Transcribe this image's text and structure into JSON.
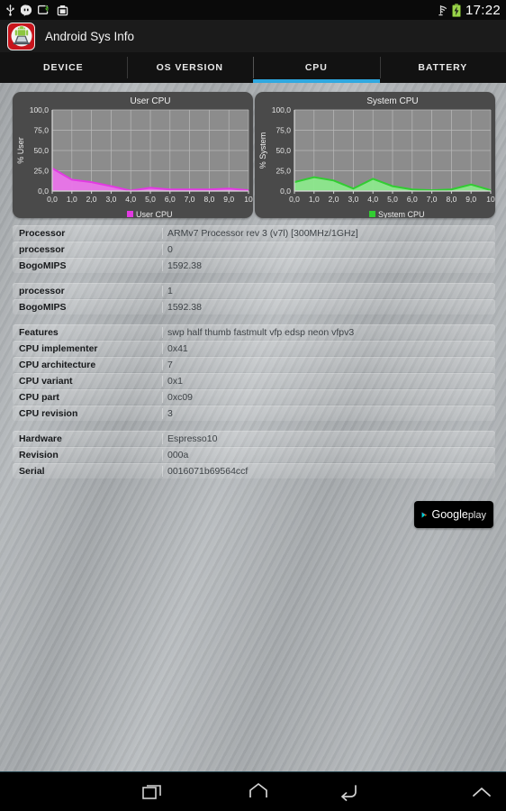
{
  "statusbar": {
    "time": "17:22",
    "icons": [
      "usb-icon",
      "hangouts-icon",
      "usb-transfer-icon",
      "screenshot-icon"
    ],
    "right_icons": [
      "wifi-icon",
      "battery-charging-icon"
    ]
  },
  "actionbar": {
    "app_title": "Android Sys Info",
    "logo": "android-sys-info-logo"
  },
  "tabs": [
    {
      "label": "DEVICE",
      "active": false
    },
    {
      "label": "OS VERSION",
      "active": false
    },
    {
      "label": "CPU",
      "active": true
    },
    {
      "label": "BATTERY",
      "active": false
    }
  ],
  "colors": {
    "accent": "#2fa8e0",
    "user_cpu": "#e23ae2",
    "user_cpu_fill": "#ea74ea",
    "system_cpu": "#32cc32",
    "system_cpu_fill": "#8ce88c",
    "chart_bg": "#8c8c8c",
    "chart_frame": "#4a4a4a"
  },
  "chart_data": [
    {
      "type": "area",
      "title": "User CPU",
      "ylabel": "% User",
      "xlabel": "",
      "legend": "User CPU",
      "legend_position": "bottom",
      "grid": true,
      "xlim": [
        0,
        10
      ],
      "ylim": [
        0,
        100
      ],
      "xticks": [
        "0,0",
        "1,0",
        "2,0",
        "3,0",
        "4,0",
        "5,0",
        "6,0",
        "7,0",
        "8,0",
        "9,0",
        "10,0"
      ],
      "yticks": [
        "0,0",
        "25,0",
        "50,0",
        "75,0",
        "100,0"
      ],
      "x": [
        0,
        1,
        2,
        3,
        4,
        5,
        6,
        7,
        8,
        9,
        10
      ],
      "values": [
        28,
        14,
        11,
        6,
        0.5,
        4,
        2,
        2,
        2,
        3,
        1
      ]
    },
    {
      "type": "area",
      "title": "System CPU",
      "ylabel": "% System",
      "xlabel": "",
      "legend": "System CPU",
      "legend_position": "bottom",
      "grid": true,
      "xlim": [
        0,
        10
      ],
      "ylim": [
        0,
        100
      ],
      "xticks": [
        "0,0",
        "1,0",
        "2,0",
        "3,0",
        "4,0",
        "5,0",
        "6,0",
        "7,0",
        "8,0",
        "9,0",
        "10,0"
      ],
      "yticks": [
        "0,0",
        "25,0",
        "50,0",
        "75,0",
        "100,0"
      ],
      "x": [
        0,
        1,
        2,
        3,
        4,
        5,
        6,
        7,
        8,
        9,
        10
      ],
      "values": [
        11,
        17,
        13,
        3,
        15,
        6,
        2,
        1,
        2,
        8,
        1
      ]
    }
  ],
  "info_groups": [
    {
      "rows": [
        {
          "label": "Processor",
          "value": "ARMv7 Processor rev 3 (v7l)   [300MHz/1GHz]"
        },
        {
          "label": "processor",
          "value": "0"
        },
        {
          "label": "BogoMIPS",
          "value": "1592.38"
        }
      ]
    },
    {
      "rows": [
        {
          "label": "processor",
          "value": "1"
        },
        {
          "label": "BogoMIPS",
          "value": "1592.38"
        }
      ]
    },
    {
      "rows": [
        {
          "label": "Features",
          "value": "swp half thumb fastmult vfp edsp neon vfpv3"
        },
        {
          "label": "CPU implementer",
          "value": "0x41"
        },
        {
          "label": "CPU architecture",
          "value": "7"
        },
        {
          "label": "CPU variant",
          "value": "0x1"
        },
        {
          "label": "CPU part",
          "value": "0xc09"
        },
        {
          "label": "CPU revision",
          "value": "3"
        }
      ]
    },
    {
      "rows": [
        {
          "label": "Hardware",
          "value": "Espresso10"
        },
        {
          "label": "Revision",
          "value": "000a"
        },
        {
          "label": "Serial",
          "value": "0016071b69564ccf"
        }
      ]
    }
  ],
  "google_play": {
    "word_google": "Google",
    "word_play": "play",
    "icon": "google-play-triangle-icon"
  },
  "navbar": {
    "buttons": [
      "recents-icon",
      "home-icon",
      "back-icon",
      "expand-up-icon"
    ]
  }
}
